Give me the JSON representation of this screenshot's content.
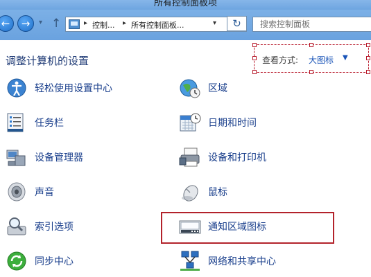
{
  "window": {
    "title": "所有控制面板项"
  },
  "nav": {
    "back_glyph": "←",
    "forward_glyph": "→",
    "recent_glyph": "▾",
    "up_glyph": "↑",
    "refresh_glyph": "↻"
  },
  "address": {
    "chevron": "▸",
    "crumbs": [
      "控制...",
      "所有控制面板..."
    ],
    "dropdown_glyph": "▾"
  },
  "search": {
    "placeholder": "搜索控制面板"
  },
  "header": {
    "title": "调整计算机的设置"
  },
  "view": {
    "label": "查看方式:",
    "value": "大图标",
    "caret": "▼"
  },
  "items_left": [
    {
      "label": "轻松使用设置中心",
      "icon": "ease-of-access-icon"
    },
    {
      "label": "任务栏",
      "icon": "taskbar-icon"
    },
    {
      "label": "设备管理器",
      "icon": "device-manager-icon"
    },
    {
      "label": "声音",
      "icon": "speaker-icon"
    },
    {
      "label": "索引选项",
      "icon": "indexing-icon"
    },
    {
      "label": "同步中心",
      "icon": "sync-icon"
    }
  ],
  "items_right": [
    {
      "label": "区域",
      "icon": "globe-clock-icon"
    },
    {
      "label": "日期和时间",
      "icon": "calendar-clock-icon"
    },
    {
      "label": "设备和打印机",
      "icon": "printer-icon"
    },
    {
      "label": "鼠标",
      "icon": "mouse-icon"
    },
    {
      "label": "通知区域图标",
      "icon": "notification-area-icon"
    },
    {
      "label": "网络和共享中心",
      "icon": "network-icon"
    }
  ],
  "colors": {
    "link": "#1a3f8c",
    "highlight": "#b3222b",
    "titlebar": "#6ea5e0"
  }
}
